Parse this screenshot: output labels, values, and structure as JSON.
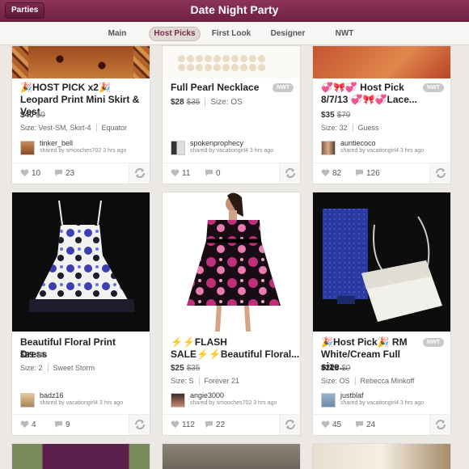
{
  "header": {
    "title": "Date Night Party",
    "back_label": "Parties"
  },
  "tabs": [
    {
      "label": "Main"
    },
    {
      "label": "Host Picks"
    },
    {
      "label": "First Look"
    },
    {
      "label": "Designer"
    },
    {
      "label": "NWT"
    }
  ],
  "colors": {
    "header": "#7a2a4a",
    "active_tab": "#e1d9d3",
    "card_bg": "#ffffff"
  },
  "listings": [
    {
      "title": "🎉HOST PICK x2🎉Leopard Print Mini Skirt & Vest",
      "price": "$40",
      "original_price": "$0",
      "size": "Size: Vest-SM, Skirt-4",
      "brand": "Equator",
      "username": "tinker_bell",
      "shared_by": "shared by smooches702 3 hrs ago",
      "likes": "10",
      "comments": "23",
      "nwt": ""
    },
    {
      "title": "Full Pearl Necklace",
      "price": "$28",
      "original_price": "$35",
      "size": "Size: OS",
      "brand": "",
      "username": "spokenprophecy",
      "shared_by": "shared by vacationgirl4 3 hrs ago",
      "likes": "11",
      "comments": "0",
      "nwt": "NWT"
    },
    {
      "title": "💞🎀💞 Host Pick 8/7/13 💞🎀💞Lace...",
      "price": "$35",
      "original_price": "$79",
      "size": "Size: 32",
      "brand": "Guess",
      "username": "auntiecoco",
      "shared_by": "shared by vacationgirl4 3 hrs ago",
      "likes": "82",
      "comments": "126",
      "nwt": "NWT"
    },
    {
      "title": "Beautiful Floral Print Dress",
      "price": "$25",
      "original_price": "$0",
      "size": "Size: 2",
      "brand": "Sweet Storm",
      "username": "badz16",
      "shared_by": "shared by vacationgirl4 3 hrs ago",
      "likes": "4",
      "comments": "9",
      "nwt": ""
    },
    {
      "title": "⚡⚡FLASH SALE⚡⚡Beautiful Floral...",
      "price": "$25",
      "original_price": "$35",
      "size": "Size: S",
      "brand": "Forever 21",
      "username": "angie3000",
      "shared_by": "shared by smooches702 3 hrs ago",
      "likes": "112",
      "comments": "22",
      "nwt": ""
    },
    {
      "title": "🎉Host Pick🎉 RM White/Cream Full size...",
      "price": "$225",
      "original_price": "$0",
      "size": "Size: OS",
      "brand": "Rebecca Minkoff",
      "username": "justblaf",
      "shared_by": "shared by vacationgirl4 3 hrs ago",
      "likes": "45",
      "comments": "24",
      "nwt": "NWT"
    }
  ]
}
